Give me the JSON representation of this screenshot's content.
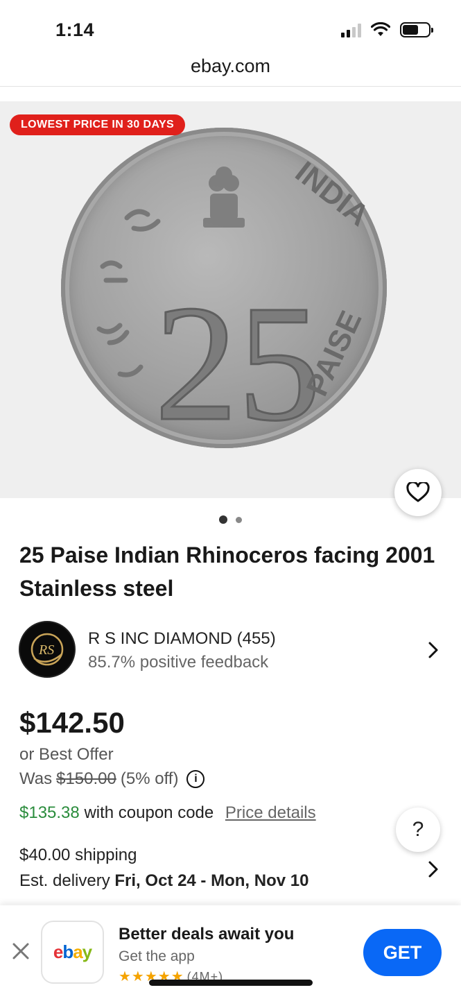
{
  "status_bar": {
    "time": "1:14"
  },
  "browser": {
    "url": "ebay.com"
  },
  "gallery": {
    "badge": "LOWEST PRICE IN 30 DAYS",
    "coin_number": "25",
    "coin_text_right": "INDIA",
    "coin_text_bottom": "PAISE",
    "total_images": 2,
    "current_image": 1
  },
  "listing": {
    "title": "25 Paise Indian Rhinoceros facing 2001 Stainless steel"
  },
  "seller": {
    "name": "R S INC DIAMOND (455)",
    "feedback": "85.7% positive feedback",
    "avatar_text": "RS"
  },
  "pricing": {
    "price": "$142.50",
    "offer": "or Best Offer",
    "was_label": "Was",
    "was_price": "$150.00",
    "discount": "(5% off)",
    "coupon_price": "$135.38",
    "coupon_text": "with coupon code",
    "price_details_link": "Price details"
  },
  "shipping": {
    "cost": "$40.00 shipping",
    "delivery_label": "Est. delivery",
    "delivery_range": "Fri, Oct 24 - Mon, Nov 10"
  },
  "help_button": {
    "label": "?"
  },
  "app_banner": {
    "title": "Better deals await you",
    "subtitle": "Get the app",
    "stars": "★★★★★",
    "rating_count": "(4M+)",
    "get_label": "GET",
    "logo_e": "e",
    "logo_b": "b",
    "logo_a": "a",
    "logo_y": "y"
  },
  "colors": {
    "badge_red": "#e0201b",
    "coupon_green": "#2a8c3c",
    "get_blue": "#0968f6"
  }
}
